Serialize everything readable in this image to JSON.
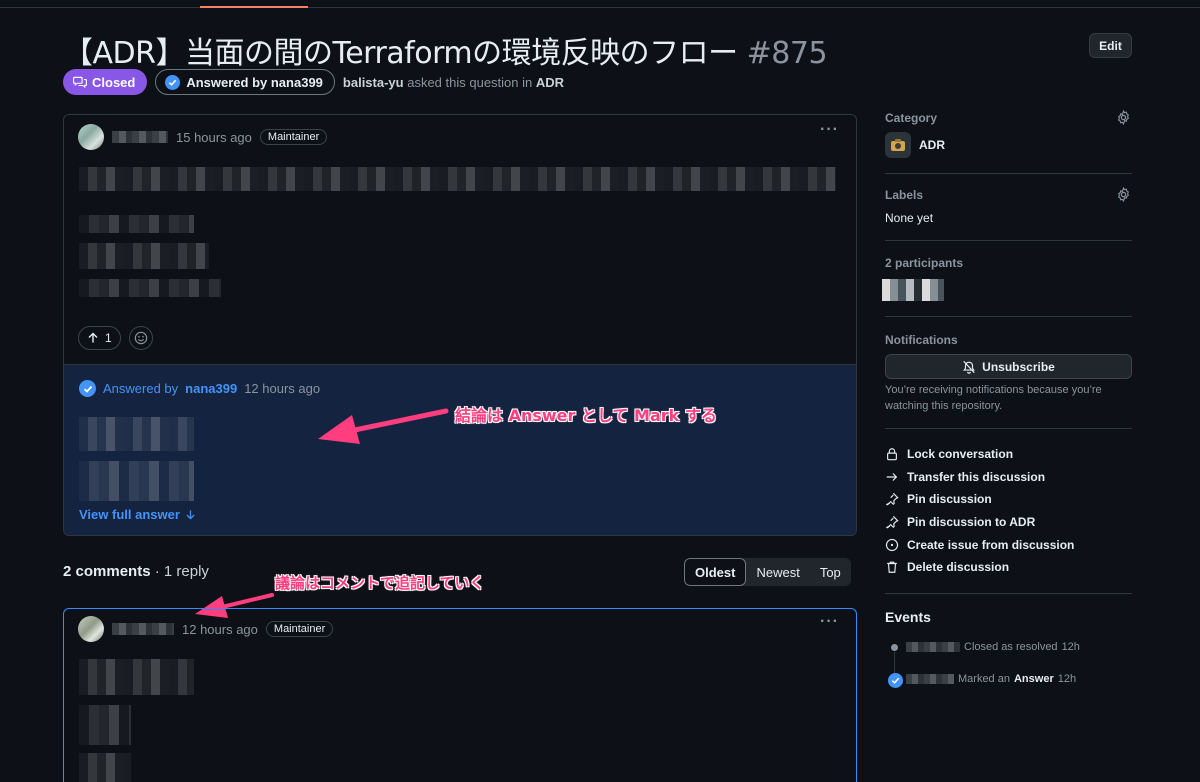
{
  "title": {
    "text": "【ADR】当面の間のTerraformの環境反映のフロー",
    "number": "#875"
  },
  "edit_label": "Edit",
  "status": {
    "closed_label": "Closed",
    "answered_label": "Answered by nana399",
    "author": "balista-yu",
    "asked_text": "asked this question in",
    "category": "ADR"
  },
  "post": {
    "time": "15 hours ago",
    "role": "Maintainer",
    "upvotes": "1"
  },
  "answer": {
    "label": "Answered by",
    "user": "nana399",
    "time": "12 hours ago",
    "view_full": "View full answer"
  },
  "comments": {
    "count_label": "2 comments",
    "reply_label": " · 1 reply",
    "sort_options": [
      "Oldest",
      "Newest",
      "Top"
    ],
    "first": {
      "time": "12 hours ago",
      "role": "Maintainer"
    }
  },
  "annotations": {
    "answer_note": "結論は Answer として Mark する",
    "comment_note": "議論はコメントで追記していく"
  },
  "sidebar": {
    "category": {
      "heading": "Category",
      "value": "ADR"
    },
    "labels": {
      "heading": "Labels",
      "value": "None yet"
    },
    "participants": {
      "heading": "2 participants"
    },
    "notifications": {
      "heading": "Notifications",
      "button": "Unsubscribe",
      "text": "You’re receiving notifications because you’re watching this repository."
    },
    "actions": [
      {
        "label": "Lock conversation",
        "icon": "lock-icon"
      },
      {
        "label": "Transfer this discussion",
        "icon": "arrow-right-icon"
      },
      {
        "label": "Pin discussion",
        "icon": "pin-icon"
      },
      {
        "label": "Pin discussion to ADR",
        "icon": "pin-icon"
      },
      {
        "label": "Create issue from discussion",
        "icon": "issue-opened-icon"
      },
      {
        "label": "Delete discussion",
        "icon": "trash-icon"
      }
    ],
    "events": {
      "heading": "Events",
      "items": [
        {
          "text": "Closed as resolved",
          "time": "12h"
        },
        {
          "pre": "Marked an",
          "bold": "Answer",
          "time": "12h"
        }
      ]
    }
  },
  "colors": {
    "background": "#0d1117",
    "closed_badge": "#8957e5",
    "link_blue": "#4493f8",
    "answer_bg": "#14233f",
    "annotation_pink": "#ff3d7f"
  }
}
